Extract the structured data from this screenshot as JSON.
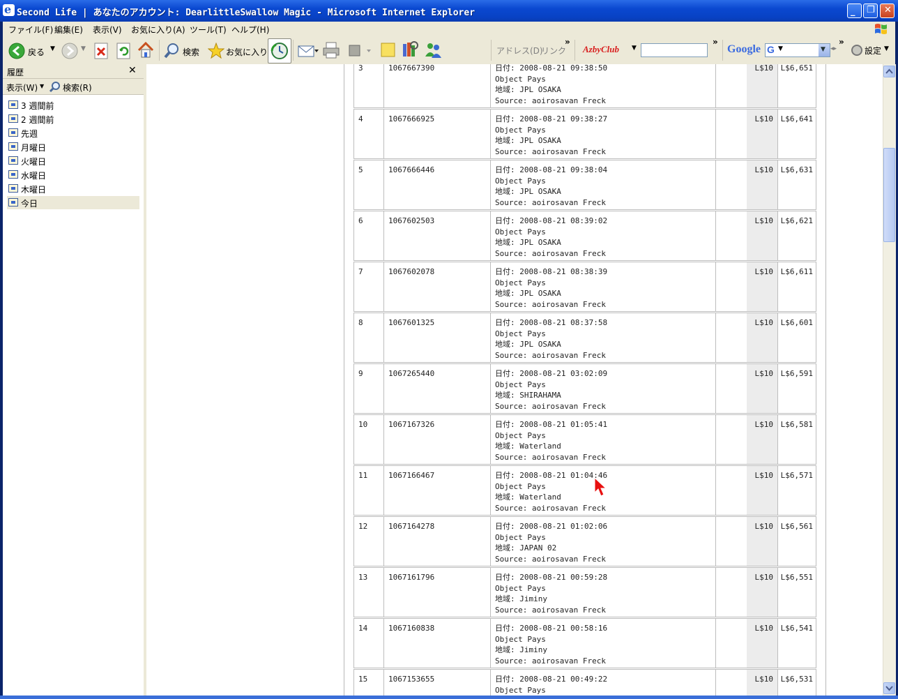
{
  "window": {
    "title": "Second Life | あなたのアカウント: DearlittleSwallow Magic - Microsoft Internet Explorer"
  },
  "menubar": {
    "items": [
      "ファイル(F)",
      "編集(E)",
      "表示(V)",
      "お気に入り(A)",
      "ツール(T)",
      "ヘルプ(H)"
    ]
  },
  "toolbar": {
    "back_label": "戻る",
    "search_label": "検索",
    "favorites_label": "お気に入り",
    "address_label": "アドレス(D)",
    "links_label": "リンク",
    "azby_label": "AzbyClub",
    "google_label": "Google",
    "google_g": "G",
    "settings_label": "設定"
  },
  "history_pane": {
    "title": "履歴",
    "view_label": "表示(W)",
    "search_label": "検索(R)",
    "items": [
      {
        "label": "3 週間前"
      },
      {
        "label": "2 週間前"
      },
      {
        "label": "先週"
      },
      {
        "label": "月曜日"
      },
      {
        "label": "火曜日"
      },
      {
        "label": "水曜日"
      },
      {
        "label": "木曜日"
      },
      {
        "label": "今日"
      }
    ],
    "selected_index": 7
  },
  "transactions": [
    {
      "num": "3",
      "id": "1067667390",
      "date": "日付: 2008-08-21 09:38:50",
      "type": "Object Pays",
      "region": "地域: JPL OSAKA",
      "source": "Source: aoirosavan Freck",
      "amount": "L$10",
      "balance": "L$6,651"
    },
    {
      "num": "4",
      "id": "1067666925",
      "date": "日付: 2008-08-21 09:38:27",
      "type": "Object Pays",
      "region": "地域: JPL OSAKA",
      "source": "Source: aoirosavan Freck",
      "amount": "L$10",
      "balance": "L$6,641"
    },
    {
      "num": "5",
      "id": "1067666446",
      "date": "日付: 2008-08-21 09:38:04",
      "type": "Object Pays",
      "region": "地域: JPL OSAKA",
      "source": "Source: aoirosavan Freck",
      "amount": "L$10",
      "balance": "L$6,631"
    },
    {
      "num": "6",
      "id": "1067602503",
      "date": "日付: 2008-08-21 08:39:02",
      "type": "Object Pays",
      "region": "地域: JPL OSAKA",
      "source": "Source: aoirosavan Freck",
      "amount": "L$10",
      "balance": "L$6,621"
    },
    {
      "num": "7",
      "id": "1067602078",
      "date": "日付: 2008-08-21 08:38:39",
      "type": "Object Pays",
      "region": "地域: JPL OSAKA",
      "source": "Source: aoirosavan Freck",
      "amount": "L$10",
      "balance": "L$6,611"
    },
    {
      "num": "8",
      "id": "1067601325",
      "date": "日付: 2008-08-21 08:37:58",
      "type": "Object Pays",
      "region": "地域: JPL OSAKA",
      "source": "Source: aoirosavan Freck",
      "amount": "L$10",
      "balance": "L$6,601"
    },
    {
      "num": "9",
      "id": "1067265440",
      "date": "日付: 2008-08-21 03:02:09",
      "type": "Object Pays",
      "region": "地域: SHIRAHAMA",
      "source": "Source: aoirosavan Freck",
      "amount": "L$10",
      "balance": "L$6,591"
    },
    {
      "num": "10",
      "id": "1067167326",
      "date": "日付: 2008-08-21 01:05:41",
      "type": "Object Pays",
      "region": "地域: Waterland",
      "source": "Source: aoirosavan Freck",
      "amount": "L$10",
      "balance": "L$6,581"
    },
    {
      "num": "11",
      "id": "1067166467",
      "date": "日付: 2008-08-21 01:04:46",
      "type": "Object Pays",
      "region": "地域: Waterland",
      "source": "Source: aoirosavan Freck",
      "amount": "L$10",
      "balance": "L$6,571"
    },
    {
      "num": "12",
      "id": "1067164278",
      "date": "日付: 2008-08-21 01:02:06",
      "type": "Object Pays",
      "region": "地域: JAPAN 02",
      "source": "Source: aoirosavan Freck",
      "amount": "L$10",
      "balance": "L$6,561"
    },
    {
      "num": "13",
      "id": "1067161796",
      "date": "日付: 2008-08-21 00:59:28",
      "type": "Object Pays",
      "region": "地域: Jiminy",
      "source": "Source: aoirosavan Freck",
      "amount": "L$10",
      "balance": "L$6,551"
    },
    {
      "num": "14",
      "id": "1067160838",
      "date": "日付: 2008-08-21 00:58:16",
      "type": "Object Pays",
      "region": "地域: Jiminy",
      "source": "Source: aoirosavan Freck",
      "amount": "L$10",
      "balance": "L$6,541"
    },
    {
      "num": "15",
      "id": "1067153655",
      "date": "日付: 2008-08-21 00:49:22",
      "type": "Object Pays",
      "region": "",
      "source": "",
      "amount": "L$10",
      "balance": "L$6,531"
    }
  ],
  "colors": {
    "titlebar": "#0a48d0",
    "chrome": "#ece9d8",
    "amount_column_bg": "#ececec"
  }
}
